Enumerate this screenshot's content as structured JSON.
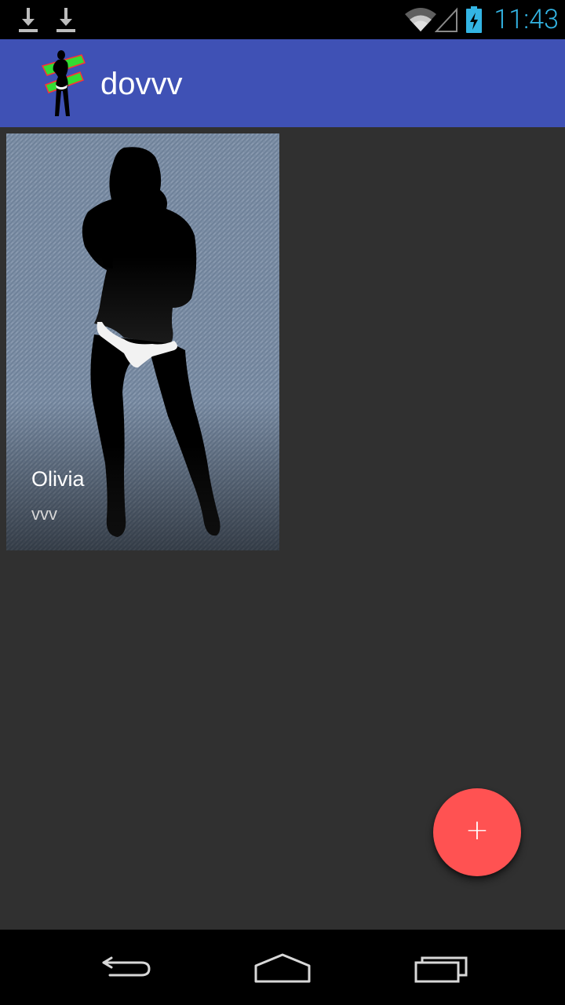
{
  "status_bar": {
    "time": "11:43",
    "time_color": "#33b5e5",
    "icons": [
      "download-icon",
      "download-icon",
      "wifi-icon",
      "signal-icon",
      "battery-charging-icon"
    ]
  },
  "app_bar": {
    "title": "dovvv",
    "background": "#3f51b5",
    "logo_icon": "silhouette-logo-icon"
  },
  "cards": [
    {
      "title": "Olivia",
      "subtitle": "vvv",
      "image": "denim-silhouette-image"
    }
  ],
  "fab": {
    "label": "+",
    "color": "#ff5252",
    "icon": "add-icon"
  },
  "nav_bar": {
    "buttons": [
      "back-icon",
      "home-icon",
      "recent-apps-icon"
    ]
  }
}
